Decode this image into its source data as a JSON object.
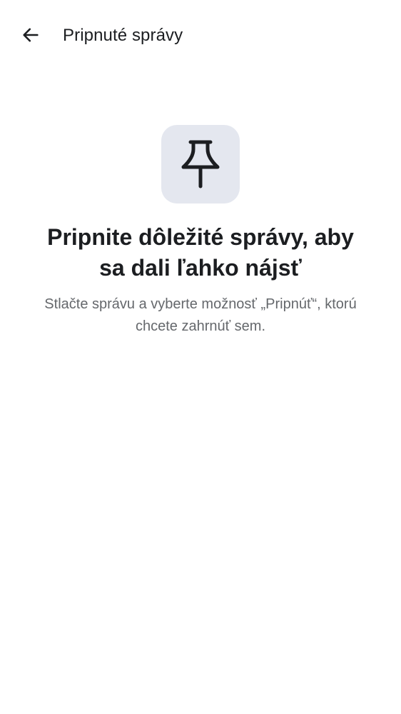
{
  "header": {
    "back_icon": "arrow-left-icon",
    "title": "Pripnuté správy"
  },
  "empty_state": {
    "icon": "pushpin-icon",
    "headline": "Pripnite dôležité správy, aby sa dali ľahko nájsť",
    "description": "Stlačte správu a vyberte možnosť „Pripnúť“, ktorú chcete zahrnúť sem."
  },
  "colors": {
    "background": "#ffffff",
    "text_primary": "#1c1e21",
    "text_secondary": "#65686c",
    "icon_tile": "#e4e7ef"
  }
}
